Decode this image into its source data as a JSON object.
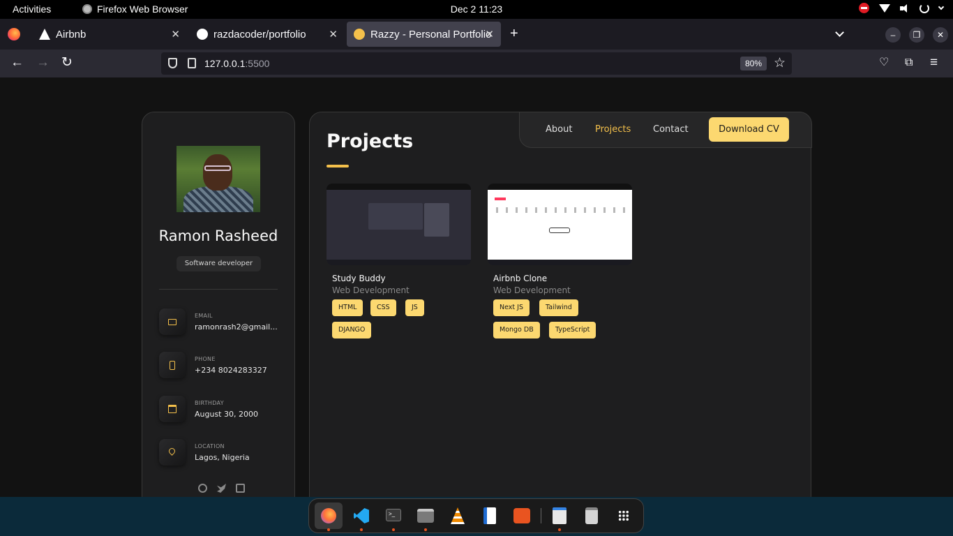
{
  "system_bar": {
    "activities": "Activities",
    "app_name": "Firefox Web Browser",
    "clock": "Dec 2  11:23"
  },
  "browser": {
    "tabs": [
      {
        "title": "Airbnb",
        "active": false
      },
      {
        "title": "razdacoder/portfolio",
        "active": false
      },
      {
        "title": "Razzy - Personal Portfolio",
        "active": true
      }
    ],
    "url_host": "127.0.0.1",
    "url_port": ":5500",
    "zoom": "80%"
  },
  "sidebar": {
    "name": "Ramon Rasheed",
    "role": "Software developer",
    "contacts": [
      {
        "label": "EMAIL",
        "value": "ramonrash2@gmail...",
        "icon": "mail-icon"
      },
      {
        "label": "PHONE",
        "value": "+234 8024283327",
        "icon": "phone-icon"
      },
      {
        "label": "BIRTHDAY",
        "value": "August 30, 2000",
        "icon": "calendar-icon"
      },
      {
        "label": "LOCATION",
        "value": "Lagos, Nigeria",
        "icon": "location-pin-icon"
      }
    ],
    "socials": [
      "github-icon",
      "twitter-icon",
      "linkedin-icon"
    ]
  },
  "nav": {
    "items": [
      "About",
      "Projects",
      "Contact"
    ],
    "active": "Projects",
    "cv_button": "Download CV"
  },
  "projects": {
    "title": "Projects",
    "cards": [
      {
        "title": "Study Buddy",
        "category": "Web Development",
        "tags": [
          "HTML",
          "CSS",
          "JS",
          "DJANGO"
        ]
      },
      {
        "title": "Airbnb Clone",
        "category": "Web Development",
        "tags": [
          "Next JS",
          "Tailwind",
          "Mongo DB",
          "TypeScript"
        ]
      }
    ]
  },
  "colors": {
    "accent": "#f4c04b",
    "button": "#fcd870",
    "panel": "#1e1e1f",
    "page_bg": "#121212"
  },
  "dock": {
    "apps": [
      "firefox-icon",
      "vscode-icon",
      "terminal-icon",
      "files-icon",
      "vlc-icon",
      "text-document-icon",
      "app-center-icon",
      "text-editor-icon",
      "trash-icon",
      "show-apps-icon"
    ]
  }
}
